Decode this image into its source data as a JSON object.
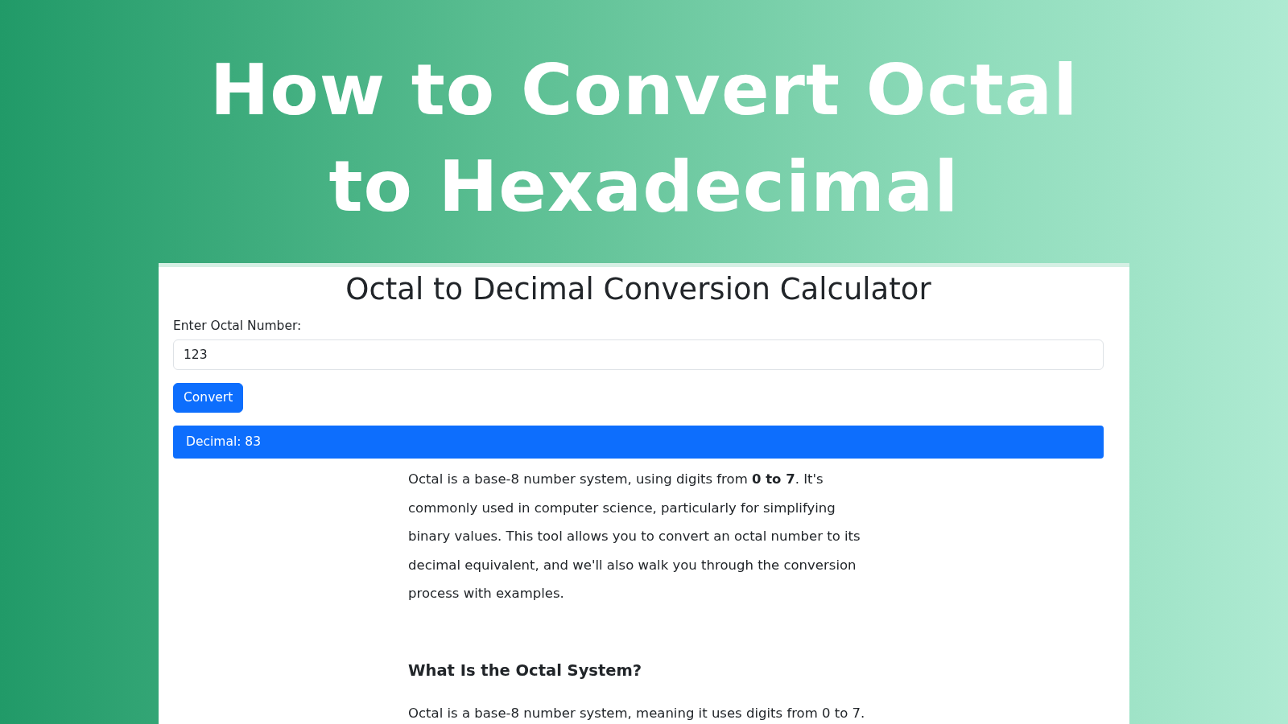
{
  "banner_title": "How to Convert Octal to Hexadecimal",
  "calculator": {
    "title": "Octal to Decimal Conversion Calculator",
    "input_label": "Enter Octal Number:",
    "input_value": "123",
    "button": "Convert",
    "result": "Decimal: 83"
  },
  "article": [
    {
      "kind": "paragraph",
      "text": "Octal is a base-8 number system, using digits from **0 to 7**. It's commonly used in computer science, particularly for simplifying binary values. This tool allows you to convert an octal number to its decimal equivalent, and we'll also walk you through the conversion process with examples."
    },
    {
      "kind": "heading",
      "text": "What Is the Octal System?"
    },
    {
      "kind": "paragraph",
      "text": "Octal is a base-8 number system, meaning it uses digits from 0 to 7."
    }
  ]
}
